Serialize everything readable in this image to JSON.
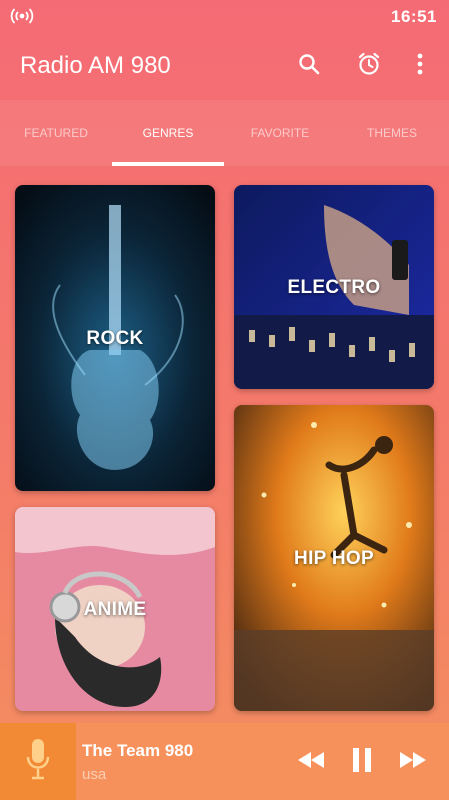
{
  "status_bar": {
    "time": "16:51",
    "icon": "radio-broadcast-icon"
  },
  "app_bar": {
    "title": "Radio AM 980",
    "actions": [
      "search-icon",
      "alarm-clock-icon",
      "more-vert-icon"
    ]
  },
  "tabs": [
    {
      "label": "FEATURED",
      "active": false
    },
    {
      "label": "GENRES",
      "active": true
    },
    {
      "label": "FAVORITE",
      "active": false
    },
    {
      "label": "THEMES",
      "active": false
    }
  ],
  "genres": [
    {
      "label": "ROCK"
    },
    {
      "label": "ELECTRO"
    },
    {
      "label": "ANIME"
    },
    {
      "label": "HIP HOP"
    }
  ],
  "player": {
    "station": "The Team 980",
    "country": "usa",
    "controls": [
      "rewind-icon",
      "pause-icon",
      "fast-forward-icon"
    ]
  },
  "colors": {
    "accent": "#f56b75",
    "player_bg": "#f7915c",
    "mic_bg": "#f28a35"
  }
}
